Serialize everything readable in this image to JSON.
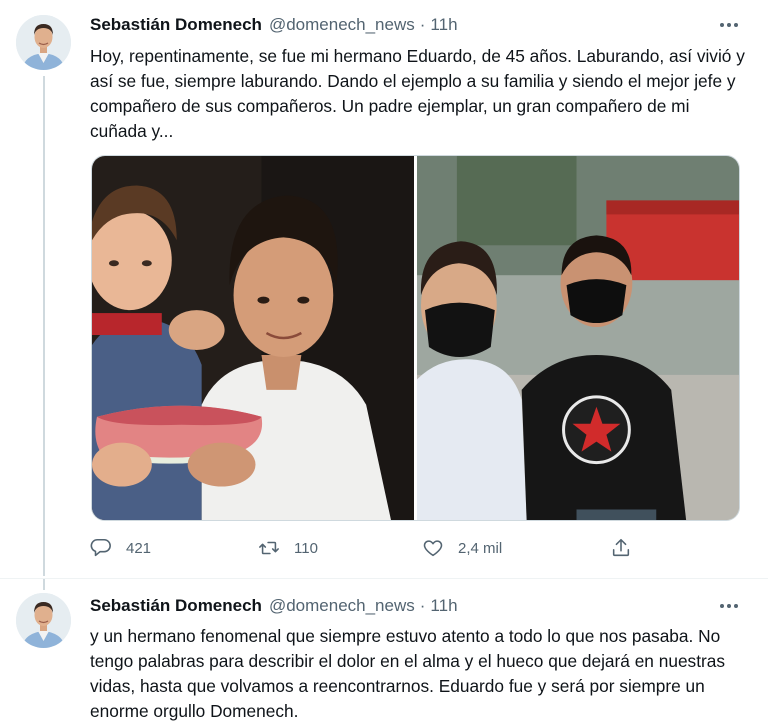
{
  "colors": {
    "text": "#0f1419",
    "secondary": "#536471",
    "thread_line": "#cfd9de",
    "background": "#ffffff"
  },
  "tweets": [
    {
      "author": {
        "name": "Sebastián Domenech",
        "handle": "@domenech_news",
        "avatar": "avatar-photo"
      },
      "separator": "·",
      "time": "11h",
      "text": "Hoy, repentinamente, se fue mi hermano Eduardo, de 45 años. Laburando, así vivió y así se fue, siempre laburando. Dando el ejemplo a su familia y siendo el mejor jefe y compañero de sus compañeros. Un padre ejemplar, un gran compañero de mi cuñada y...",
      "media": [
        "childhood-photo",
        "masked-brothers-photo"
      ],
      "stats": {
        "replies": "421",
        "retweets": "110",
        "likes": "2,4 mil"
      },
      "icons": {
        "reply": "reply-icon",
        "retweet": "retweet-icon",
        "like": "heart-icon",
        "share": "share-icon",
        "more": "more-icon"
      }
    },
    {
      "author": {
        "name": "Sebastián Domenech",
        "handle": "@domenech_news",
        "avatar": "avatar-photo"
      },
      "separator": "·",
      "time": "11h",
      "text": "y un hermano fenomenal que siempre estuvo atento a todo lo que nos pasaba. No tengo palabras para describir el dolor en el alma y el hueco que dejará en nuestras vidas, hasta que volvamos a reencontrarnos. Eduardo fue y será por siempre un enorme orgullo Domenech.",
      "icons": {
        "more": "more-icon"
      }
    }
  ]
}
